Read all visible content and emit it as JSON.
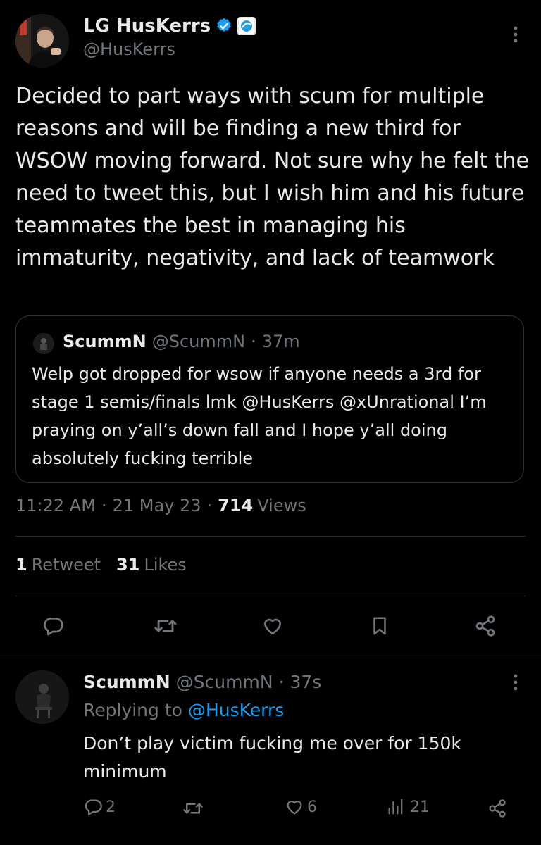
{
  "tweet": {
    "author_name": "LG HusKerrs",
    "author_handle": "@HusKerrs",
    "text": "Decided to part ways with scum for multiple reasons and will be finding a new third for WSOW moving forward. Not sure why he felt the need to tweet this, but I wish him and his future teammates the best in managing his immaturity, negativity, and lack of teamwork",
    "quoted": {
      "author_name": "ScummN",
      "author_handle": "@ScummN",
      "separator": "·",
      "time": "37m",
      "text": "Welp got dropped for wsow if anyone needs a 3rd for stage 1 semis/finals lmk @HusKerrs @xUnrational I’m praying on y’all’s down fall and I hope y’all doing absolutely fucking terrible"
    },
    "meta": {
      "time": "11:22 AM",
      "date": "21 May 23",
      "views_count": "714",
      "views_label": "Views",
      "separator": "·"
    },
    "stats": {
      "retweets_count": "1",
      "retweets_label": "Retweet",
      "likes_count": "31",
      "likes_label": "Likes"
    },
    "actions": [
      "reply-icon",
      "retweet-icon",
      "like-icon",
      "bookmark-icon",
      "share-icon"
    ]
  },
  "reply": {
    "author_name": "ScummN",
    "author_handle": "@ScummN",
    "separator": "·",
    "time": "37s",
    "replying_to_label": "Replying to",
    "replying_to_handle": "@HusKerrs",
    "text": "Don’t play victim fucking me over for 150k minimum",
    "actions": {
      "reply_count": "2",
      "like_count": "6",
      "views_count": "21"
    }
  },
  "colors": {
    "background": "#000000",
    "text": "#e7e9ea",
    "muted": "#71767b",
    "link": "#1d9bf0",
    "verified": "#1d9bf0",
    "divider": "#2f3336"
  }
}
